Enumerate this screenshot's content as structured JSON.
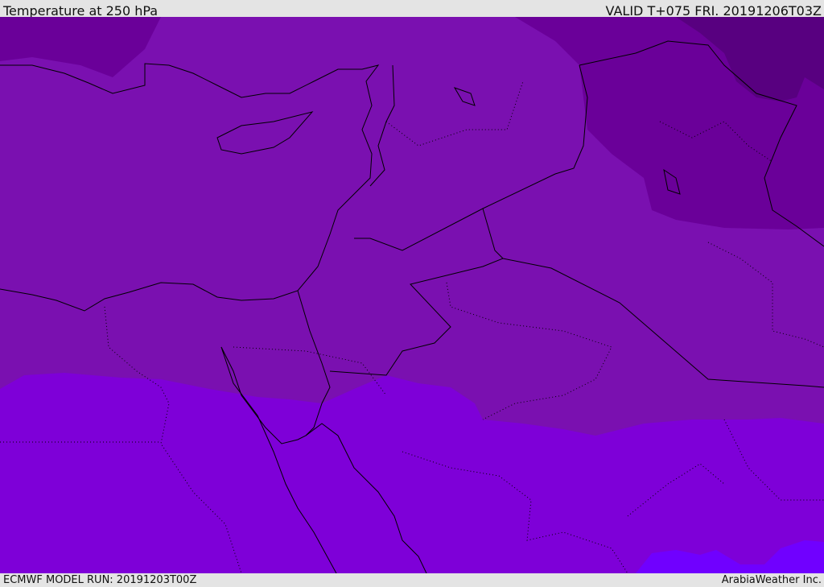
{
  "header": {
    "title": "Temperature at 250 hPa",
    "valid": "VALID T+075 FRI. 20191206T03Z"
  },
  "footer": {
    "model_run": "ECMWF MODEL RUN: 20191203T00Z",
    "credit": "ArabiaWeather Inc."
  },
  "colors": {
    "band_mid": "#7a10b0",
    "band_north": "#6a0099",
    "band_cold": "#580080",
    "band_south": "#7e00d8",
    "band_warm": "#7000ff"
  }
}
